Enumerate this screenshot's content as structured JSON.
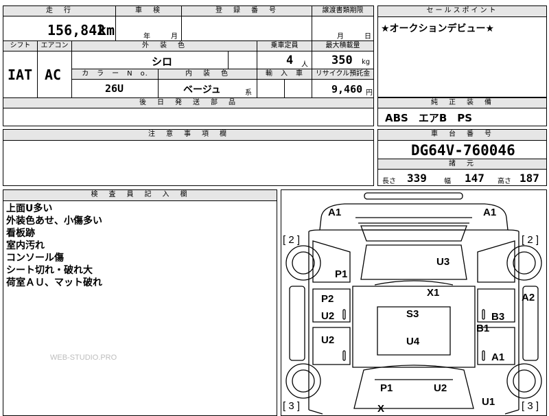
{
  "top": {
    "mileage_header": "走　行",
    "mileage_value": "156,842",
    "mileage_unit": "km",
    "inspection_header": "車　検",
    "inspection_year_unit": "年",
    "inspection_month_unit": "月",
    "registration_header": "登　録　番　号",
    "transfer_header": "譲渡書類期限",
    "transfer_month_unit": "月",
    "transfer_day_unit": "日"
  },
  "row2": {
    "shift_header": "シフト",
    "aircon_header": "エアコン",
    "exterior_color_header": "外　装　色",
    "capacity_header": "乗車定員",
    "max_load_header": "最大積載量",
    "shift_value": "IAT",
    "aircon_value": "AC",
    "exterior_color_value": "シロ",
    "capacity_value": "4",
    "capacity_unit": "人",
    "max_load_value": "350",
    "max_load_unit": "kg",
    "color_no_header": "カ　ラ　ー　N　o.",
    "interior_color_header": "内　装　色",
    "import_header": "輸　入　車",
    "recycle_header": "リサイクル預託金",
    "color_no_value": "26U",
    "interior_color_value": "ベージュ",
    "interior_color_suffix": "系",
    "recycle_value": "9,460",
    "recycle_unit": "円",
    "later_parts_header": "後　日　発　送　部　品"
  },
  "sales_point": {
    "header": "セールスポイント",
    "text": "★オークションデビュー★"
  },
  "equipment": {
    "header": "純　正　装　備",
    "text": "ABS　エアB　PS"
  },
  "caution": {
    "header": "注　意　事　項　欄"
  },
  "chassis": {
    "header": "車　台　番　号",
    "value": "DG64V-760046",
    "specs_header": "諸　元",
    "length_label": "長さ",
    "length_value": "339",
    "width_label": "幅",
    "width_value": "147",
    "height_label": "高さ",
    "height_value": "187"
  },
  "inspector": {
    "header": "検　査　員　記　入　欄",
    "notes": [
      "上面U多い",
      "外装色あせ、小傷多い",
      "看板跡",
      "室内汚れ",
      "コンソール傷",
      "シート切れ・破れ大",
      "荷室ＡＵ、マット破れ"
    ]
  },
  "diagram": {
    "labels": {
      "a1_left": "A1",
      "a1_right": "A1",
      "p1_upper": "P1",
      "u3": "U3",
      "x1": "X1",
      "p2": "P2",
      "a2": "A2",
      "u2_upper": "U2",
      "s3": "S3",
      "b3": "B3",
      "b1": "B1",
      "u2_lower": "U2",
      "u4": "U4",
      "a1_lower": "A1",
      "p1_lower": "P1",
      "u2_bottom": "U2",
      "u1": "U1",
      "x": "X"
    },
    "brackets": {
      "left_top": "[ 2 ]",
      "right_top": "[ 2 ]",
      "left_bottom": "[ 3 ]",
      "right_bottom": "[ 3 ]"
    }
  },
  "watermark": "WEB-STUDIO.PRO"
}
